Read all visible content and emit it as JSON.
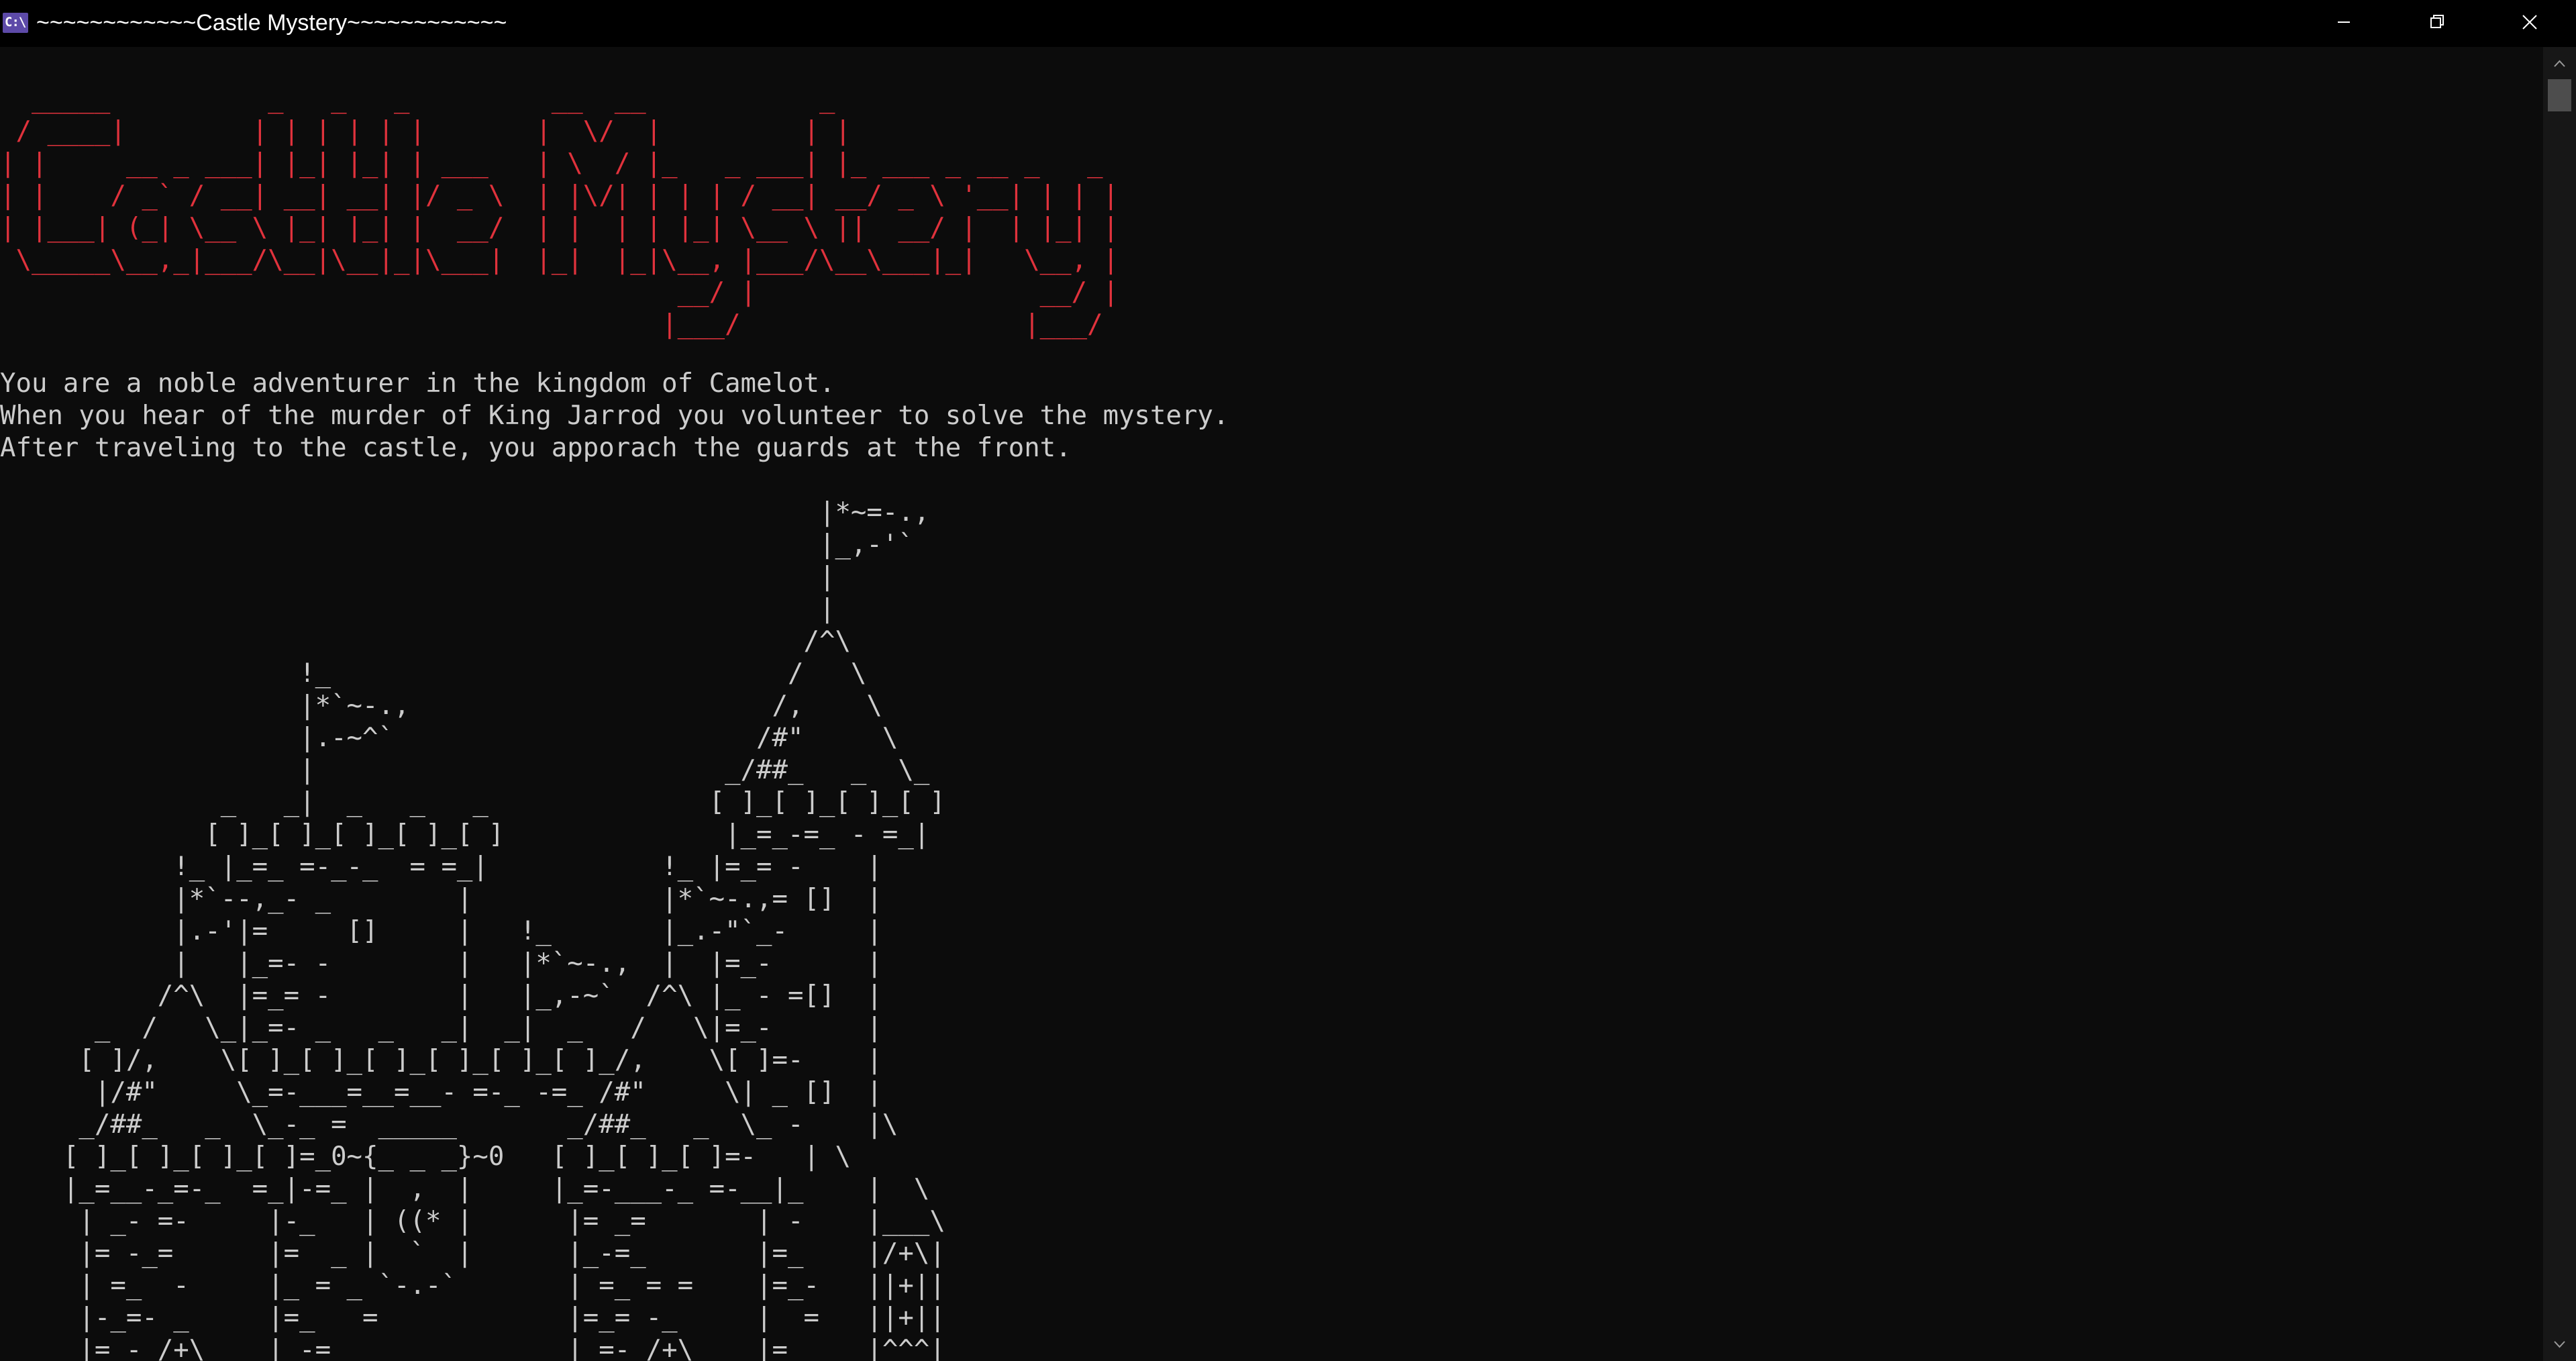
{
  "window": {
    "title": "~~~~~~~~~~~~Castle Mystery~~~~~~~~~~~~",
    "icon": "console-icon",
    "icon_glyph": "C:\\",
    "controls": [
      "minimize-icon",
      "restore-icon",
      "close-icon"
    ]
  },
  "colors": {
    "background": "#0c0c0c",
    "titlebar": "#000000",
    "banner": "#e0323c",
    "text": "#cccccc",
    "scrollbar_track": "#171717",
    "scrollbar_thumb": "#4d4d4d"
  },
  "console": {
    "banner_art": "  _____          _   _   _         __  __           _\n / ____|        | | | | | |       |  \\/  |         | |\n| |     __ _ ___| |_| |_| | ___   | \\  / |_   _ ___| |_ ___ _ __ _   _\n| |    / _` / __| __| __| |/ _ \\  | |\\/| | | | / __| __/ _ \\ '__| | | |\n| |___| (_| \\__ \\ |_| |_| |  __/  | |  | | |_| \\__ \\ ||  __/ |  | |_| |\n \\_____\\__,_|___/\\__|\\__|_|\\___|  |_|  |_|\\__, |___/\\__\\___|_|   \\__, |\n                                           __/ |                  __/ |\n                                          |___/                  |___/",
    "intro_lines": [
      "You are a noble adventurer in the kingdom of Camelot.",
      "When you hear of the murder of King Jarrod you volunteer to solve the mystery.",
      "After traveling to the castle, you apporach the guards at the front."
    ],
    "castle_art": "                                                    |*~=-.,\n                                                    |_,-'`\n                                                    |\n                                                    |\n                                                   /^\\\n                   !_                             /   \\\n                   |*`~-.,                       /,    \\\n                   |.-~^`                       /#\"     \\\n                   |                          _/##_   _  \\_\n              _   _|  _   _   _              [ ]_[ ]_[ ]_[ ]\n             [ ]_[ ]_[ ]_[ ]_[ ]              |_=_-=_ - =_|\n           !_ |_=_ =-_-_  = =_|           !_ |=_= -    |\n           |*`--,_- _        |            |*`~-.,= []  |\n           |.-'|=     []     |   !_       |_.-\"`_-     |\n           |   |_=- -        |   |*`~-.,  |  |=_-      |\n          /^\\  |=_= -        |   |_,-~`  /^\\ |_ - =[]  |\n      _  /   \\_|_=- _   _   _|  _|  _   /   \\|=_-      |\n     [ ]/,    \\[ ]_[ ]_[ ]_[ ]_[ ]_[ ]_/,    \\[ ]=-    |\n      |/#\"     \\_=-___=__=__- =-_ -=_ /#\"     \\| _ []  |\n     _/##_   _  \\_-_ =  _____       _/##_   _  \\_ -    |\\\n    [ ]_[ ]_[ ]_[ ]=_0~{_ _ _}~0   [ ]_[ ]_[ ]=-   | \\\n    |_=__-_=-_  =_|-=_ |  ,  |     |_=-___-_ =-__|_    |  \\\n     | _- =-     |-_   | ((* |      |= _=       | -    |___\\\n     |= -_=      |=  _ |  `  |      |_-=_       |=_    |/+\\|\n     | =_  -     |_ = _ `-.-`       | =_ = =    |=_-   ||+||\n     |-_=- _     |=_   =            |=_= -_     |  =   ||+||\n     |= - /+\\    | -=               | =- /+\\    |=     |^^^|"
  }
}
